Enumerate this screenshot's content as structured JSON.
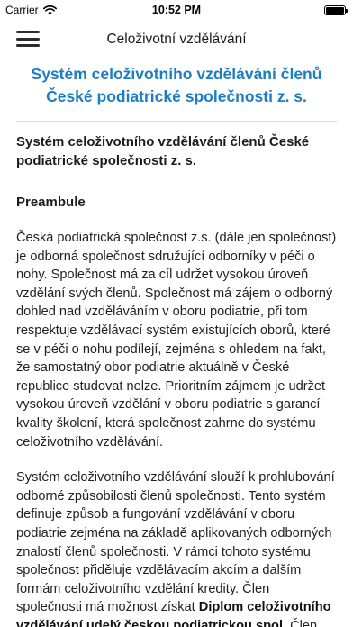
{
  "status": {
    "carrier": "Carrier",
    "time": "10:52 PM",
    "battery_level": 1.0
  },
  "nav": {
    "title": "Celoživotní vzdělávání",
    "menu_icon": "hamburger-menu-icon"
  },
  "article": {
    "heading": "Systém celoživotního vzdělávání členů České podiatrické společnosti z. s.",
    "subheading": "Systém celoživotního vzdělávání členů České podiatrické společnosti z. s.",
    "section_title": "Preambule",
    "paragraph_1": "Česká podiatrická společnost z.s. (dále jen společnost) je odborná společnost sdružující odborníky v péči o nohy. Společnost má za cíl udržet vysokou úroveň vzdělání svých členů. Společnost má zájem o odborný dohled nad vzděláváním v oboru podiatrie, při tom respektuje vzdělávací systém existujících oborů, které se v péči o nohu podílejí, zejména s ohledem na fakt, že samostatný obor podiatrie  aktuálně v České republice studovat nelze.  Prioritním zájmem je udržet vysokou úroveň vzdělání v oboru podiatrie s garancí kvality školení, která společnost zahrne do systému celoživotního vzdělávání.",
    "paragraph_2_text": " Systém celoživotního vzdělávání slouží k prohlubování odborné způsobilosti členů společnosti. Tento systém definuje způsob a fungování vzdělávání v oboru podiatrie zejména na základě aplikovaných odborných znalostí členů společnosti. V rámci tohoto systému společnost přiděluje vzdělávacím akcím a dalším formám celoživotního vzdělání kredity. Člen společnosti má možnost získat ",
    "paragraph_2_bold": "Diplom celoživotního vzdělávání udelý českou podiatrickou spol.",
    "paragraph_2_tail": "  Člen společnosti"
  }
}
